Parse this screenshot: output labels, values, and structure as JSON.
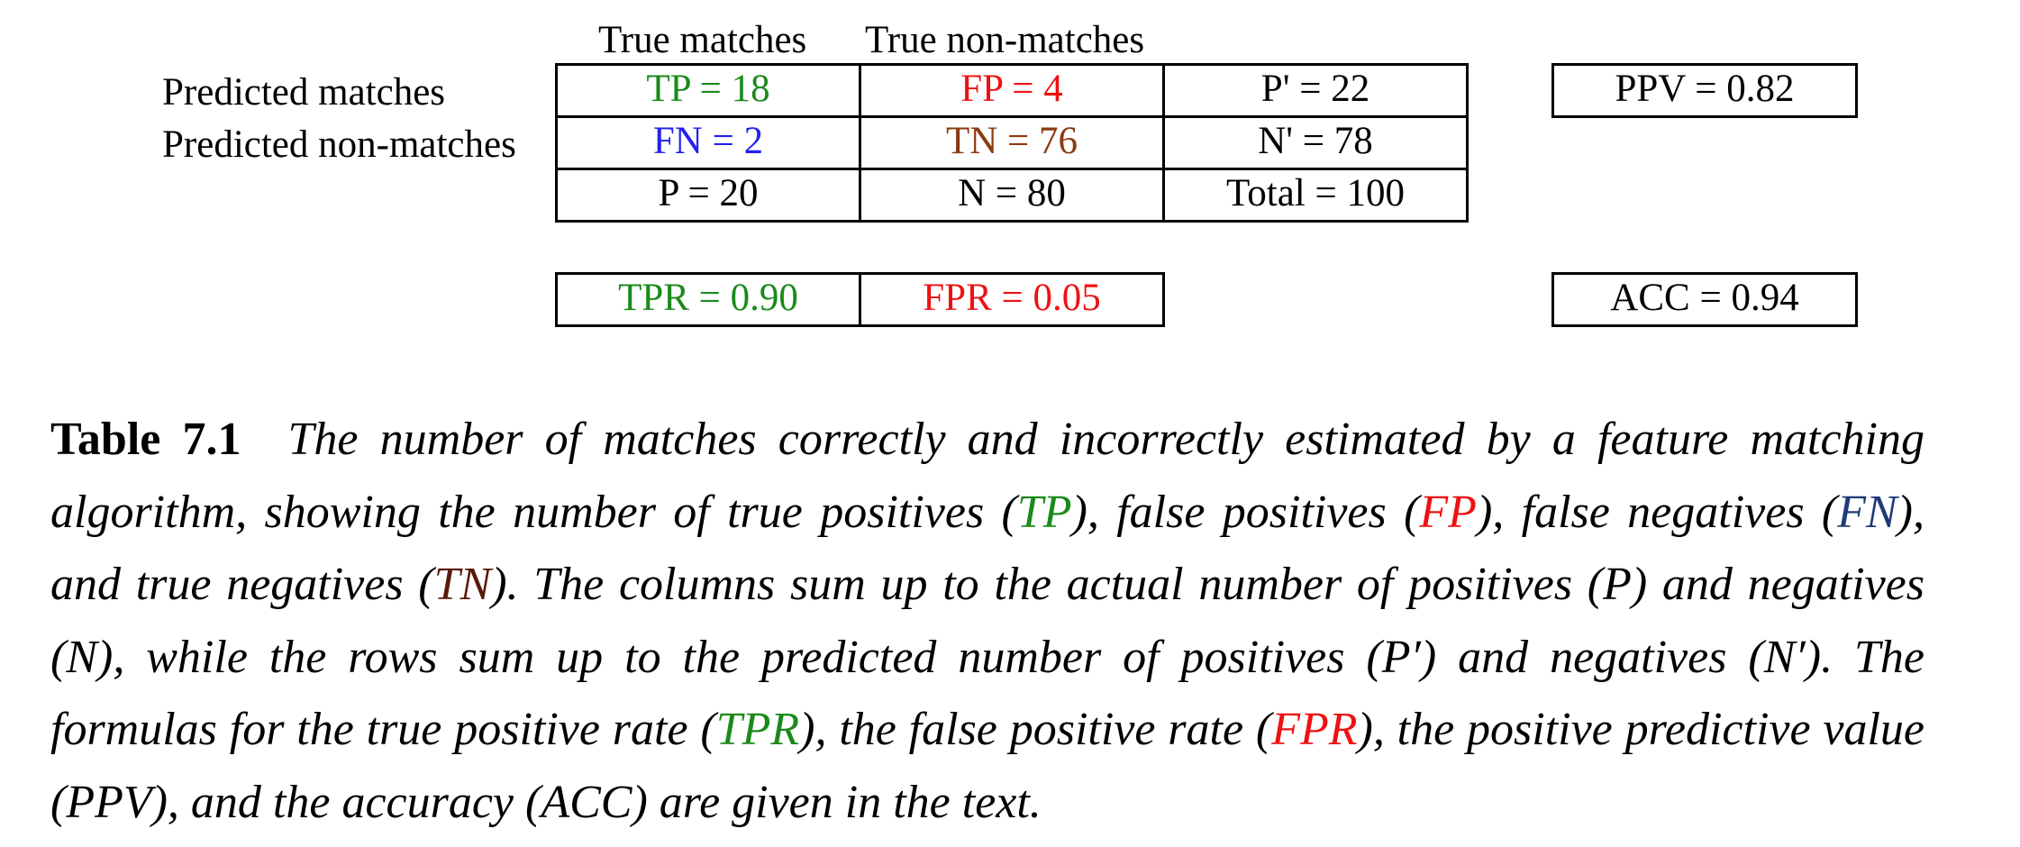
{
  "table": {
    "col_headers": [
      "True matches",
      "True non-matches"
    ],
    "row_labels": [
      "Predicted matches",
      "Predicted non-matches"
    ],
    "cells": {
      "tp": "TP = 18",
      "fp": "FP = 4",
      "p_prime": "P' = 22",
      "fn": "FN = 2",
      "tn": "TN = 76",
      "n_prime": "N' = 78",
      "p": "P = 20",
      "n": "N = 80",
      "total": "Total = 100"
    },
    "metrics": {
      "ppv": "PPV = 0.82",
      "tpr": "TPR = 0.90",
      "fpr": "FPR = 0.05",
      "acc": "ACC = 0.94"
    }
  },
  "colors": {
    "green": "#1a8a1a",
    "red": "#ee1111",
    "blue": "#2222ee",
    "brown": "#8b3a10",
    "navy": "#1f3a78",
    "dark_brown": "#5a1a0a"
  },
  "caption": {
    "label": "Table 7.1",
    "parts": {
      "t1": "The number of matches correctly and incorrectly estimated by a feature matching algorithm, showing the number of true positives (",
      "tp": "TP",
      "t2": "), false positives (",
      "fp": "FP",
      "t3": "), false negatives (",
      "fn": "FN",
      "t4": "), and true negatives (",
      "tn": "TN",
      "t5": "). The columns sum up to the actual number of positives (P) and negatives (N), while the rows sum up to the predicted number of positives (P′) and negatives (N′). The formulas for the true positive rate (",
      "tpr": "TPR",
      "t6": "), the false positive rate (",
      "fpr": "FPR",
      "t7": "), the positive predictive value (PPV), and the accuracy (ACC) are given in the text."
    }
  }
}
